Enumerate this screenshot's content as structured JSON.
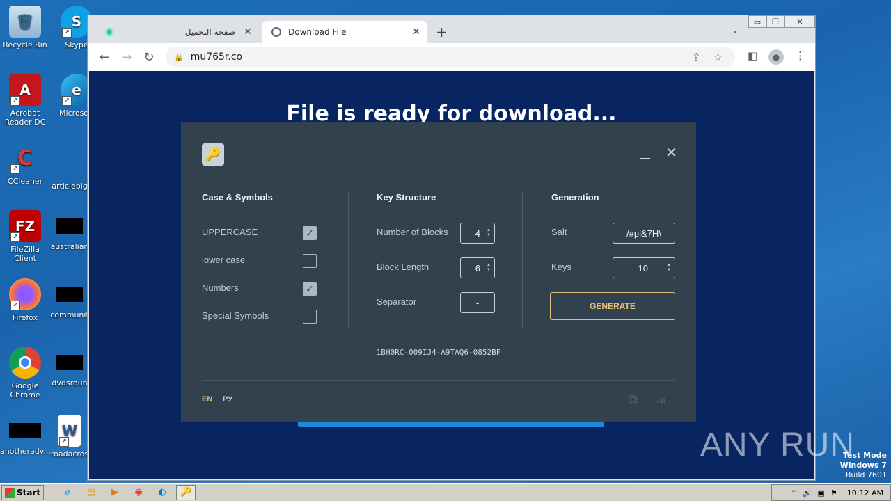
{
  "desktop": {
    "icons": [
      {
        "label": "Recycle Bin"
      },
      {
        "label": "Skype"
      },
      {
        "label": "Acrobat Reader DC"
      },
      {
        "label": "Microsoft"
      },
      {
        "label": "CCleaner"
      },
      {
        "label": "articlebig"
      },
      {
        "label": "FileZilla Client"
      },
      {
        "label": "australian"
      },
      {
        "label": "Firefox"
      },
      {
        "label": "communit"
      },
      {
        "label": "Google Chrome"
      },
      {
        "label": "dvdsroun"
      },
      {
        "label": "anotheradv..."
      },
      {
        "label": "roadacros"
      }
    ]
  },
  "browser": {
    "tabs": [
      {
        "title": "صفحة التحميل",
        "active": false
      },
      {
        "title": "Download File",
        "active": true
      }
    ],
    "url": "mu765r.co",
    "page_heading": "File is ready for download..."
  },
  "keygen": {
    "columns": {
      "case_symbols": "Case & Symbols",
      "key_structure": "Key Structure",
      "generation": "Generation"
    },
    "options": [
      {
        "label": "UPPERCASE",
        "checked": true
      },
      {
        "label": "lower case",
        "checked": false
      },
      {
        "label": "Numbers",
        "checked": true
      },
      {
        "label": "Special Symbols",
        "checked": false
      }
    ],
    "structure": {
      "blocks_label": "Number of Blocks",
      "blocks_value": "4",
      "length_label": "Block Length",
      "length_value": "6",
      "separator_label": "Separator",
      "separator_value": "-"
    },
    "generation": {
      "salt_label": "Salt",
      "salt_value": "/#pl&7H\\",
      "keys_label": "Keys",
      "keys_value": "10",
      "generate_label": "GENERATE"
    },
    "result": "1BH0RC-009IJ4-A9TAQ6-0852BF",
    "languages": [
      "EN",
      "РУ"
    ],
    "accent_color": "#e8c27a"
  },
  "taskbar": {
    "start_label": "Start",
    "clock": "10:12 AM"
  },
  "watermark": "ANY RUN",
  "test_mode": {
    "line1": "Test Mode",
    "line2": "Windows 7",
    "line3": "Build 7601"
  }
}
